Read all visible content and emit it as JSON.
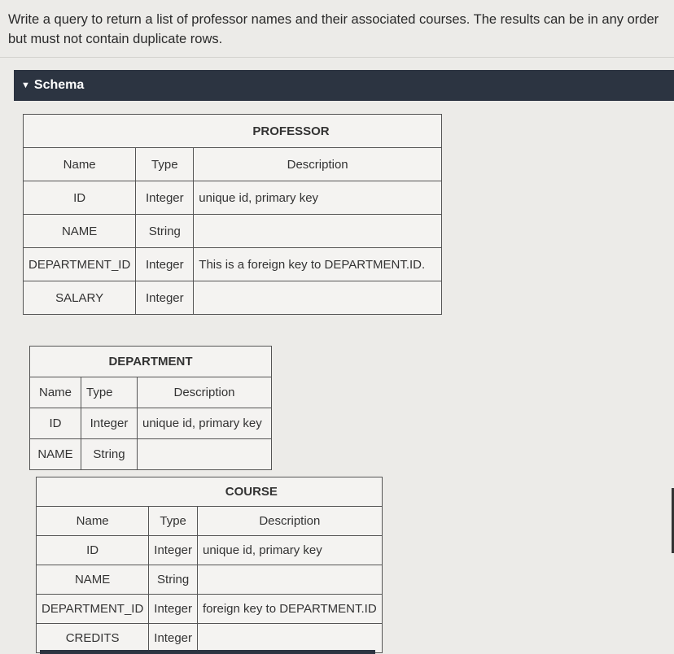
{
  "question": {
    "prompt": "Write a query to return a list of professor names and their associated courses. The results can be in any order but must not contain duplicate rows."
  },
  "schema": {
    "header_label": "Schema",
    "tables": [
      {
        "title": "PROFESSOR",
        "columns": [
          "Name",
          "Type",
          "Description"
        ],
        "rows": [
          [
            "ID",
            "Integer",
            "unique id, primary key"
          ],
          [
            "NAME",
            "String",
            ""
          ],
          [
            "DEPARTMENT_ID",
            "Integer",
            "This is a foreign key to DEPARTMENT.ID."
          ],
          [
            "SALARY",
            "Integer",
            ""
          ]
        ]
      },
      {
        "title": "DEPARTMENT",
        "columns": [
          "Name",
          "Type",
          "Description"
        ],
        "rows": [
          [
            "ID",
            "Integer",
            "unique id, primary key"
          ],
          [
            "NAME",
            "String",
            ""
          ]
        ]
      },
      {
        "title": "COURSE",
        "columns": [
          "Name",
          "Type",
          "Description"
        ],
        "rows": [
          [
            "ID",
            "Integer",
            "unique id, primary key"
          ],
          [
            "NAME",
            "String",
            ""
          ],
          [
            "DEPARTMENT_ID",
            "Integer",
            "foreign key to DEPARTMENT.ID"
          ],
          [
            "CREDITS",
            "Integer",
            ""
          ]
        ]
      }
    ]
  },
  "colors": {
    "header_bar": "#2c3441",
    "background": "#ecebe8"
  }
}
